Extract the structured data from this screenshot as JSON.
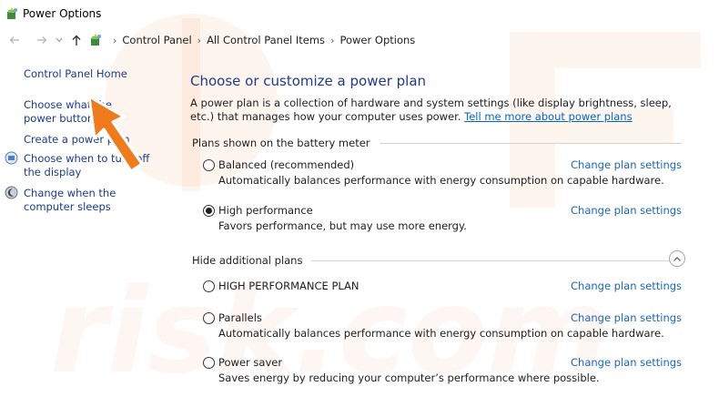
{
  "window": {
    "title": "Power Options"
  },
  "addressbar": {
    "crumbs": [
      "Control Panel",
      "All Control Panel Items",
      "Power Options"
    ]
  },
  "leftnav": {
    "home": "Control Panel Home",
    "buttons": "Choose what the power buttons do",
    "create": "Create a power plan",
    "display": "Choose when to turn off the display",
    "sleep": "Change when the computer sleeps"
  },
  "main": {
    "title": "Choose or customize a power plan",
    "description": "A power plan is a collection of hardware and system settings (like display brightness, sleep, etc.) that manages how your computer uses power.",
    "tell_more": "Tell me more about power plans",
    "group_battery": "Plans shown on the battery meter",
    "group_hidden": "Hide additional plans",
    "change_label": "Change plan settings",
    "plans": [
      {
        "name": "Balanced (recommended)",
        "desc": "Automatically balances performance with energy consumption on capable hardware.",
        "selected": false
      },
      {
        "name": "High performance",
        "desc": "Favors performance, but may use more energy.",
        "selected": true
      },
      {
        "name": "HIGH PERFORMANCE PLAN",
        "desc": "",
        "selected": false
      },
      {
        "name": "Parallels",
        "desc": "Automatically balances performance with energy consumption on capable hardware.",
        "selected": false
      },
      {
        "name": "Power saver",
        "desc": "Saves energy by reducing your computer’s performance where possible.",
        "selected": false
      }
    ]
  },
  "watermark": {
    "text": "risk.com"
  },
  "colors": {
    "link": "#1a66c0",
    "title": "#1e3a8a",
    "arrow": "#f07b1d"
  },
  "icons": {
    "app": "power-options-icon",
    "back": "arrow-left-icon",
    "forward": "arrow-right-icon",
    "up": "arrow-up-icon",
    "display": "display-power-icon",
    "sleep": "sleep-moon-icon",
    "collapse": "chevron-up-icon"
  }
}
